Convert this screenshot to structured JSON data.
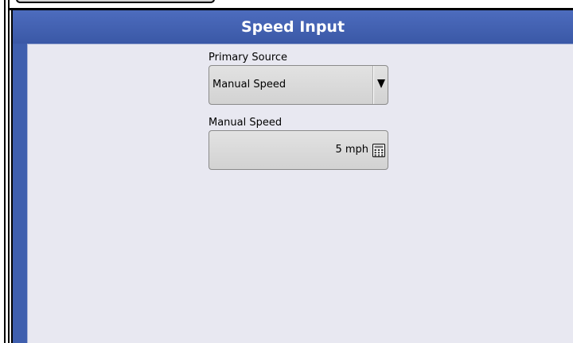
{
  "dialog": {
    "title": "Speed Input"
  },
  "primary_source": {
    "label": "Primary Source",
    "value": "Manual Speed"
  },
  "manual_speed": {
    "label": "Manual Speed",
    "value": "5 mph"
  },
  "icons": {
    "dropdown": "triangle-down-icon",
    "keypad": "calculator-icon"
  },
  "colors": {
    "title_bar": "#3f5fae",
    "body_background": "#e8e8f1",
    "control": "#d6d6d6"
  }
}
